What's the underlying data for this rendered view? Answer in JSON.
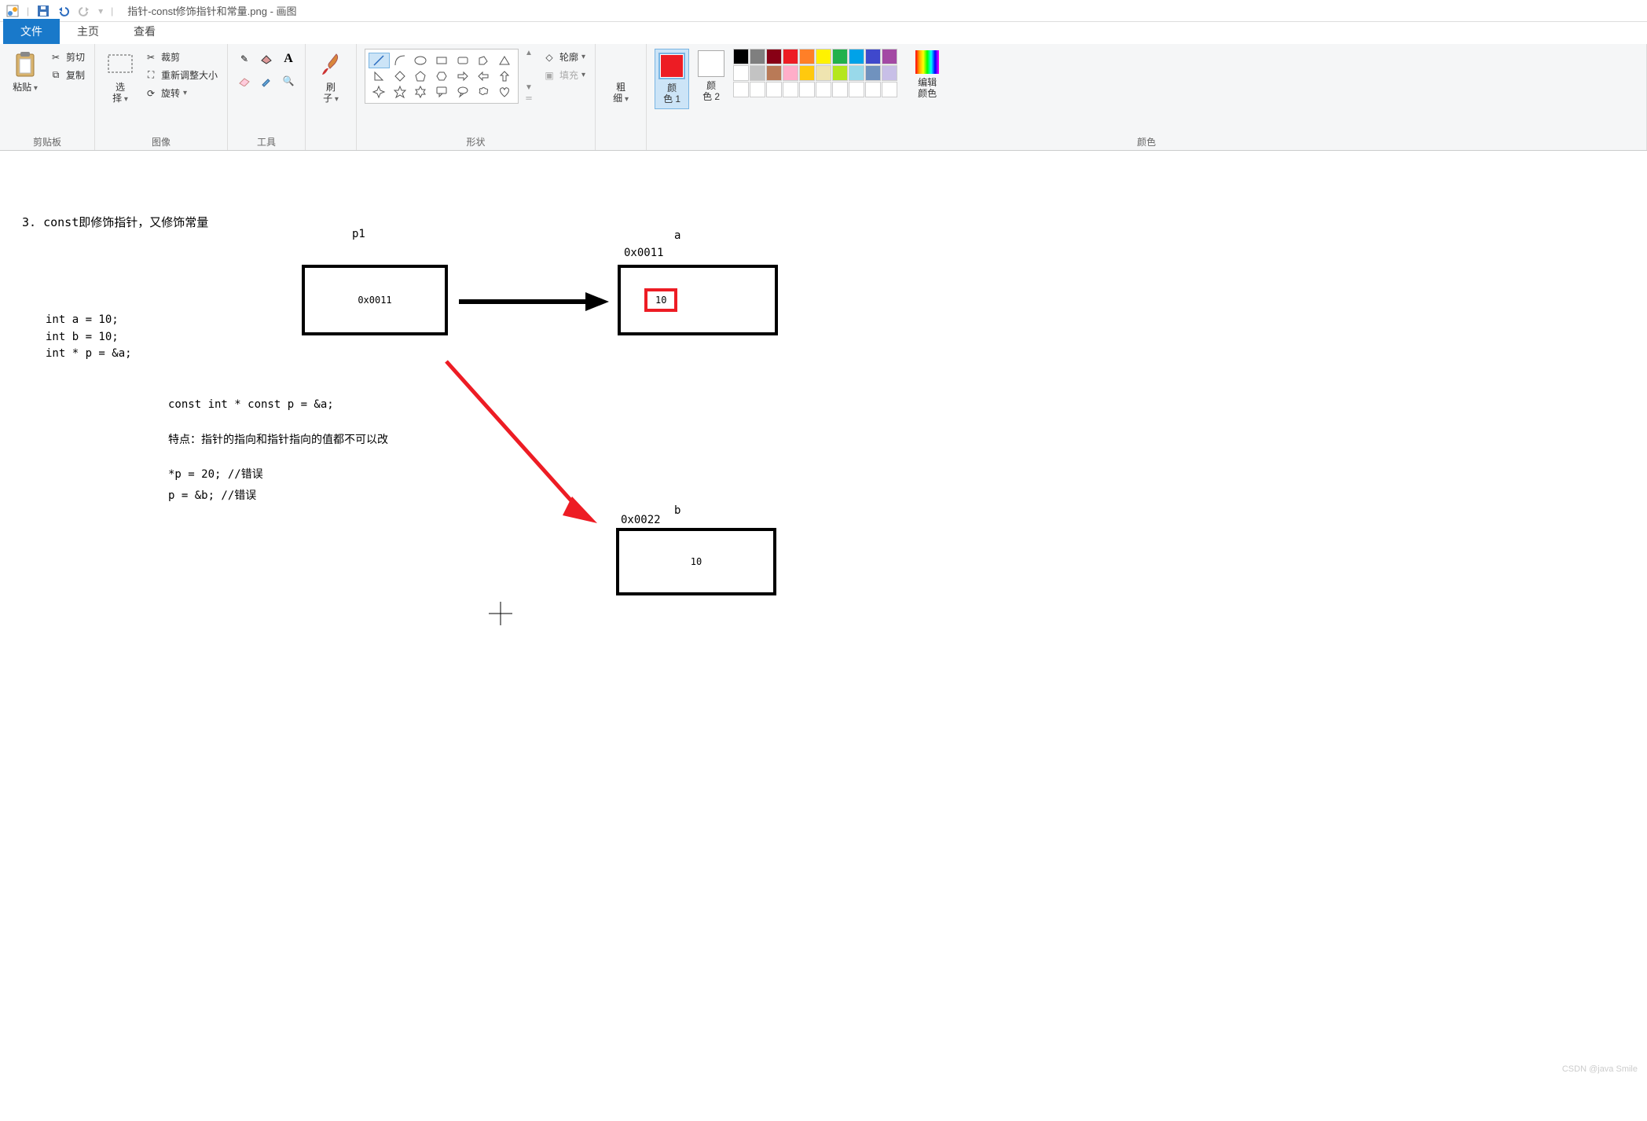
{
  "title_bar": {
    "doc_name": "指针-const修饰指针和常量.png",
    "app_name": "画图"
  },
  "tabs": {
    "file": "文件",
    "home": "主页",
    "view": "查看"
  },
  "clipboard": {
    "paste": "粘贴",
    "cut": "剪切",
    "copy": "复制",
    "group": "剪贴板"
  },
  "image": {
    "select": "选\n择",
    "crop": "裁剪",
    "resize": "重新调整大小",
    "rotate": "旋转",
    "group": "图像"
  },
  "tools": {
    "group": "工具"
  },
  "brush": {
    "label": "刷\n子",
    "group": ""
  },
  "shapes": {
    "outline": "轮廓",
    "fill": "填充",
    "group": "形状"
  },
  "stroke": {
    "label": "粗\n细"
  },
  "colors": {
    "color1": "颜\n色 1",
    "color2": "颜\n色 2",
    "edit": "编辑\n颜色",
    "group": "颜色",
    "palette": [
      "#000000",
      "#7F7F7F",
      "#880015",
      "#ED1C24",
      "#FF7F27",
      "#FFF200",
      "#22B14C",
      "#00A2E8",
      "#3F48CC",
      "#A349A4",
      "#FFFFFF",
      "#C3C3C3",
      "#B97A57",
      "#FFAEC9",
      "#FFC90E",
      "#EFE4B0",
      "#B5E61D",
      "#99D9EA",
      "#7092BE",
      "#C8BFE7",
      "#FFFFFF",
      "#FFFFFF",
      "#FFFFFF",
      "#FFFFFF",
      "#FFFFFF",
      "#FFFFFF",
      "#FFFFFF",
      "#FFFFFF",
      "#FFFFFF",
      "#FFFFFF"
    ]
  },
  "canvas": {
    "heading": "3. const即修饰指针，又修饰常量",
    "code": {
      "l1": "int a = 10;",
      "l2": "int b = 10;",
      "l3": "int * p = &a;",
      "decl": "const int * const p = &a;",
      "note": "特点：指针的指向和指针指向的值都不可以改",
      "err1": "*p = 20; //错误",
      "err2": "p = &b;  //错误"
    },
    "labels": {
      "p1": "p1",
      "a": "a",
      "b": "b",
      "addr_a": "0x0011",
      "addr_b": "0x0022",
      "val_p": "0x0011",
      "val_a": "10",
      "val_b": "10"
    }
  },
  "watermark": "CSDN @java Smile"
}
